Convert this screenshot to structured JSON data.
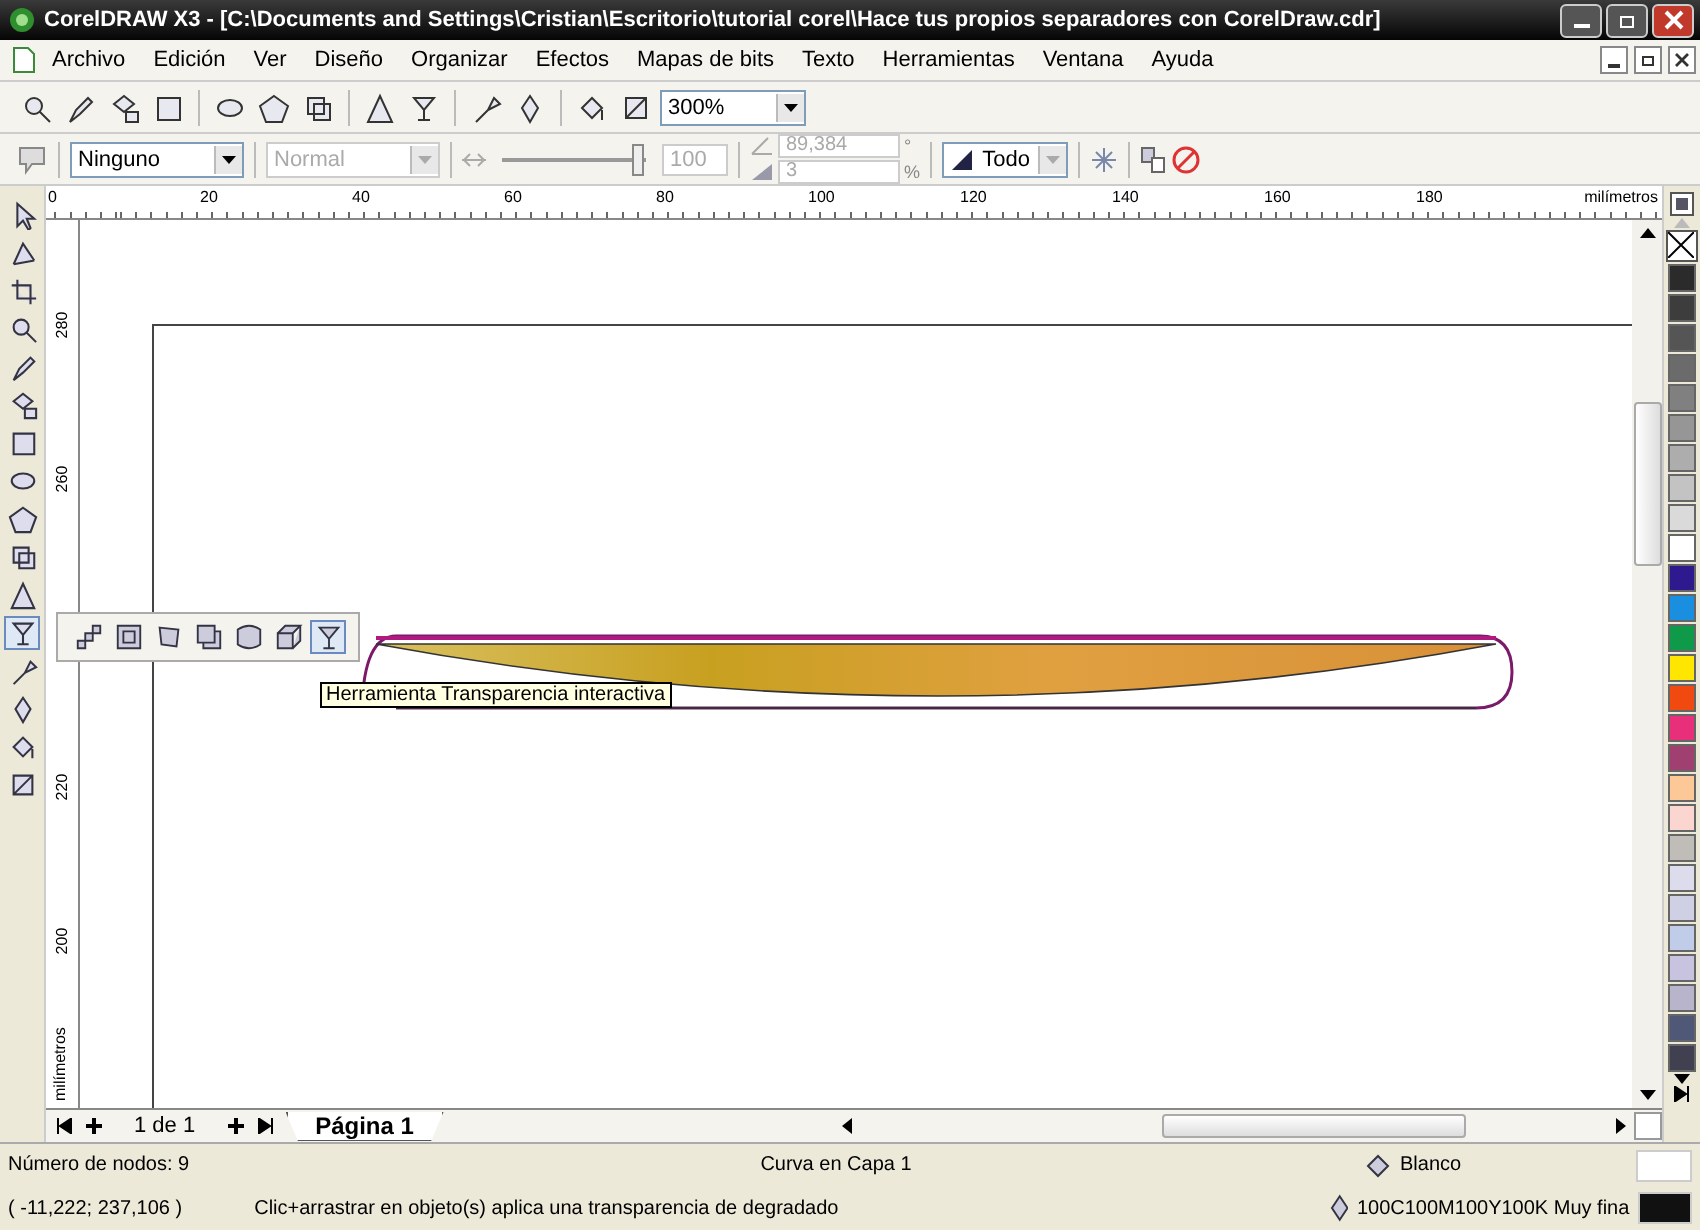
{
  "window": {
    "title": "CorelDRAW X3 - [C:\\Documents and Settings\\Cristian\\Escritorio\\tutorial corel\\Hace tus propios separadores con CorelDraw.cdr]"
  },
  "menu": [
    "Archivo",
    "Edición",
    "Ver",
    "Diseño",
    "Organizar",
    "Efectos",
    "Mapas de bits",
    "Texto",
    "Herramientas",
    "Ventana",
    "Ayuda"
  ],
  "toolbar": {
    "zoom": "300%"
  },
  "property_bar": {
    "style": "Ninguno",
    "mode": {
      "value": "Normal",
      "disabled": true
    },
    "opacity": {
      "level": 0.95,
      "value": "100",
      "disabled": true
    },
    "angle": {
      "value": "89,384",
      "unit": "°",
      "disabled": true
    },
    "border": {
      "value": "3",
      "unit": "%",
      "disabled": true
    },
    "target": "Todo"
  },
  "rulers": {
    "horizontal": [
      "0",
      "20",
      "40",
      "60",
      "80",
      "100",
      "120",
      "140",
      "160",
      "180"
    ],
    "horizontal_unit": "milímetros",
    "vertical": [
      "280",
      "260",
      "220",
      "200"
    ],
    "vertical_unit": "milímetros"
  },
  "toolbox": [
    {
      "selected": false
    },
    {
      "selected": false
    },
    {
      "selected": false
    },
    {
      "selected": false
    },
    {
      "selected": false
    },
    {
      "selected": false
    },
    {
      "selected": false
    },
    {
      "selected": false
    },
    {
      "selected": false
    },
    {
      "selected": false
    },
    {
      "selected": false
    },
    {
      "selected": true
    },
    {
      "selected": false
    },
    {
      "selected": false
    },
    {
      "selected": false
    },
    {
      "selected": false
    }
  ],
  "flyout": [
    {
      "selected": false
    },
    {
      "selected": false
    },
    {
      "selected": false
    },
    {
      "selected": false
    },
    {
      "selected": false
    },
    {
      "selected": false
    },
    {
      "selected": true
    }
  ],
  "tooltip": "Herramienta Transparencia interactiva",
  "palette": [
    {
      "color": "#2b2b2b"
    },
    {
      "color": "#3d3d3d"
    },
    {
      "color": "#555555"
    },
    {
      "color": "#6b6b6b"
    },
    {
      "color": "#808080"
    },
    {
      "color": "#969696"
    },
    {
      "color": "#adadad"
    },
    {
      "color": "#c3c3c3"
    },
    {
      "color": "#dadada"
    },
    {
      "color": "#ffffff"
    },
    {
      "color": "#2e1a8e"
    },
    {
      "color": "#1a8fe0"
    },
    {
      "color": "#0f9a4a"
    },
    {
      "color": "#ffe600"
    },
    {
      "color": "#f04a10"
    },
    {
      "color": "#e8307a"
    },
    {
      "color": "#a04070"
    },
    {
      "color": "#fdc898"
    },
    {
      "color": "#fbd5d0"
    },
    {
      "color": "#c0bcb8"
    },
    {
      "color": "#dcdcec"
    },
    {
      "color": "#d0d0e4"
    },
    {
      "color": "#c0cce8"
    },
    {
      "color": "#c8c4e0"
    },
    {
      "color": "#b8b4cc"
    },
    {
      "color": "#505878"
    },
    {
      "color": "#404050"
    }
  ],
  "pager": {
    "count": "1 de 1",
    "tab": "Página 1"
  },
  "status_bar": {
    "nodes": "Número de nodos: 9",
    "object": "Curva en Capa 1",
    "fill": "Blanco",
    "coords": "( -11,222; 237,106 )",
    "hint": "Clic+arrastrar en objeto(s) aplica una transparencia de degradado",
    "outline": "100C100M100Y100K Muy fina"
  }
}
